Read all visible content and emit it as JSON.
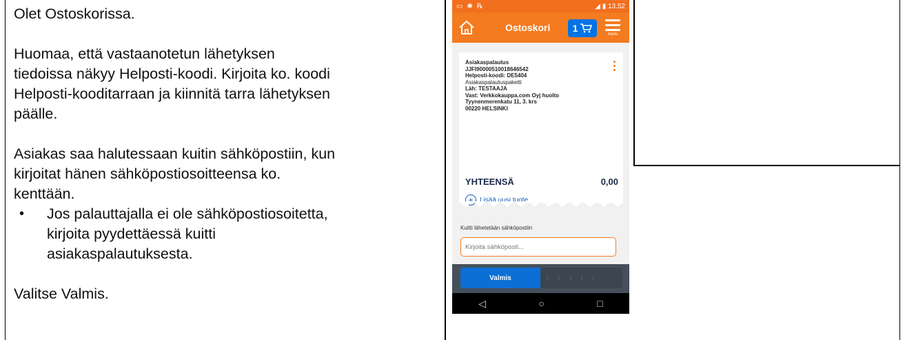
{
  "instructions": {
    "line1": "Olet Ostoskorissa.",
    "para2": [
      "Huomaa, että vastaanotetun lähetyksen",
      "tiedoissa näkyy Helposti-koodi. Kirjoita ko. koodi",
      "Helposti-kooditarraan ja kiinnitä tarra lähetyksen",
      "päälle."
    ],
    "para3": [
      "Asiakas saa halutessaan kuitin sähköpostiin, kun",
      "kirjoitat hänen sähköpostiosoitteensa ko.",
      "kenttään."
    ],
    "bullet": [
      "Jos palauttajalla ei ole sähköpostiosoitetta,",
      "kirjoita pyydettäessä kuitti",
      "asiakaspalautuksesta."
    ],
    "final": "Valitse Valmis."
  },
  "phone": {
    "status_time": "13.52",
    "title": "Ostoskori",
    "cart_count": "1",
    "menu_label": "menu",
    "item": {
      "type": "Asiakaspalautus",
      "tracking": "JJFI90000510018646542",
      "helposti": "Helposti-koodi: DE5404",
      "product": "Asiakaspalautuspaketti",
      "sender": "Läh: TESTAAJA",
      "recipient": "Vast: Verkkokauppa.com Oyj huolto",
      "address": "Tyynenmerenkatu 11, 3. krs",
      "postal": "00220 HELSINKI"
    },
    "total_label": "YHTEENSÄ",
    "total_value": "0,00",
    "add_label": "Lisää uusi tuote",
    "email_label": "Kuitti lähetetään sähköpostiin",
    "email_placeholder": "Kirjoita sähköposti...",
    "done_label": "Valmis"
  }
}
